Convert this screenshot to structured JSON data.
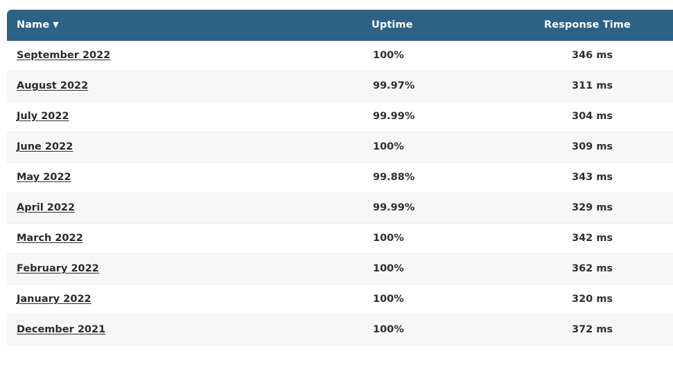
{
  "table": {
    "sort": {
      "column": "Name",
      "direction": "descending",
      "caret_glyph": "▼"
    },
    "columns": [
      {
        "key": "name",
        "label": "Name"
      },
      {
        "key": "uptime",
        "label": "Uptime"
      },
      {
        "key": "response",
        "label": "Response Time"
      }
    ],
    "rows": [
      {
        "name": "September 2022",
        "uptime": "100%",
        "response": "346 ms"
      },
      {
        "name": "August 2022",
        "uptime": "99.97%",
        "response": "311 ms"
      },
      {
        "name": "July 2022",
        "uptime": "99.99%",
        "response": "304 ms"
      },
      {
        "name": "June 2022",
        "uptime": "100%",
        "response": "309 ms"
      },
      {
        "name": "May 2022",
        "uptime": "99.88%",
        "response": "343 ms"
      },
      {
        "name": "April 2022",
        "uptime": "99.99%",
        "response": "329 ms"
      },
      {
        "name": "March 2022",
        "uptime": "100%",
        "response": "342 ms"
      },
      {
        "name": "February 2022",
        "uptime": "100%",
        "response": "362 ms"
      },
      {
        "name": "January 2022",
        "uptime": "100%",
        "response": "320 ms"
      },
      {
        "name": "December 2021",
        "uptime": "100%",
        "response": "372 ms"
      }
    ]
  },
  "colors": {
    "header_background": "#2d6186",
    "header_text": "#ffffff",
    "row_background": "#ffffff",
    "row_alt_background": "#f7f7f7",
    "row_border": "#ededed",
    "cell_text": "#2f2f2f",
    "link_text": "#2b2b2b",
    "page_background": "#ffffff"
  }
}
